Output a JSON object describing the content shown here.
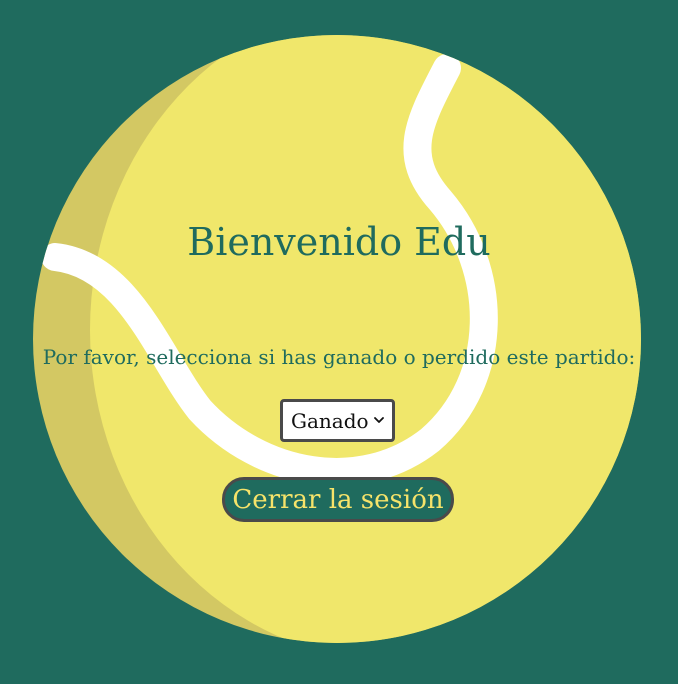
{
  "header": {
    "title": "Bienvenido Edu"
  },
  "main": {
    "prompt": "Por favor, selecciona si has ganado o perdido este partido:",
    "result_select": {
      "selected": "Ganado"
    },
    "logout_label": "Cerrar la sesión"
  },
  "icons": {
    "select_chevron": "chevron-down-icon",
    "background": "tennis-ball-icon"
  },
  "colors": {
    "background": "#1f6b5e",
    "ball": "#f0e76b",
    "ball_shadow": "#d3c863",
    "seam": "#ffffff",
    "title_text": "#1f6b5e",
    "button_bg": "#1f6b5e",
    "button_text": "#f6e36a",
    "border": "#4a4a4a"
  }
}
